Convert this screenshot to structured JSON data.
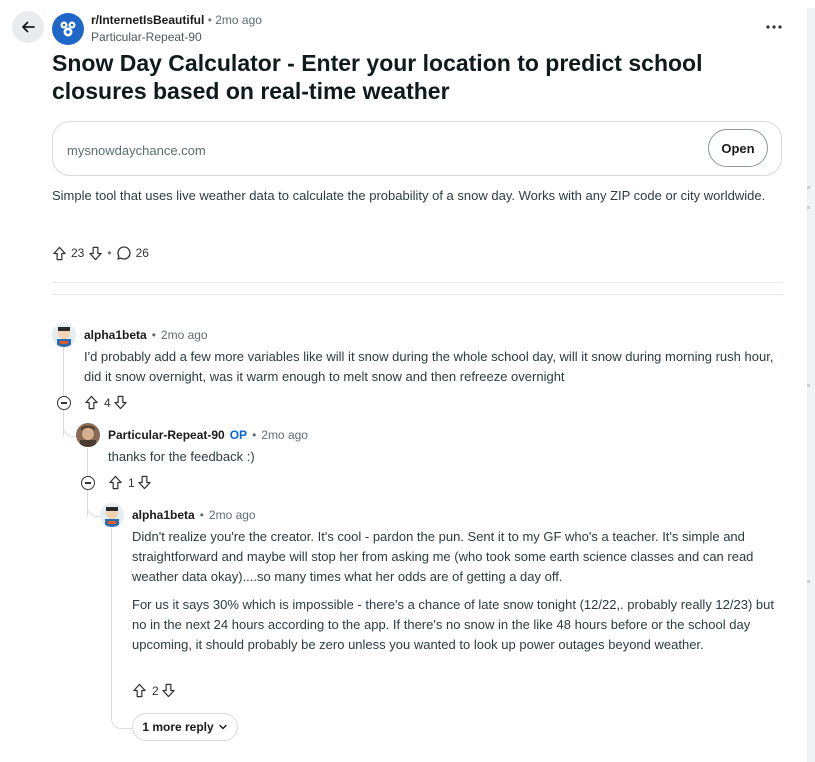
{
  "post": {
    "subreddit": "r/InternetIsBeautiful",
    "time": "2mo ago",
    "author": "Particular-Repeat-90",
    "title": "Snow Day Calculator - Enter your location to predict school closures based on real-time weather",
    "link_url": "mysnowdaychance.com",
    "open_label": "Open",
    "body": "Simple tool that uses live weather data to calculate the probability of a snow day. Works with any ZIP code or city worldwide.",
    "score": "23",
    "comment_count": "26"
  },
  "comments": [
    {
      "author": "alpha1beta",
      "time": "2mo ago",
      "text": "I'd probably add a few more variables like will it snow during the whole school day, will it snow during morning rush hour, did it snow overnight, was it warm enough to melt snow and then refreeze overnight",
      "score": "4"
    },
    {
      "author": "Particular-Repeat-90",
      "op_label": "OP",
      "time": "2mo ago",
      "text": "thanks for the feedback :)",
      "score": "1"
    },
    {
      "author": "alpha1beta",
      "time": "2mo ago",
      "text_p1": "Didn't realize you're the creator. It's cool - pardon the pun. Sent it to my GF who's a teacher. It's simple and straightforward and maybe will stop her from asking me (who took some earth science classes and can read weather data okay)....so many times what her odds are of getting a day off.",
      "text_p2": "For us it says 30% which is impossible - there's a chance of late snow tonight (12/22,. probably really 12/23) but no in the next 24 hours according to the app. If there's no snow in the like 48 hours before or the school day upcoming, it should probably be zero unless you wanted to look up power outages beyond weather.",
      "score": "2"
    }
  ],
  "more_replies_label": "1 more reply",
  "separator_dot": "•",
  "colors": {
    "op_blue": "#0a66d8",
    "subreddit_icon_bg": "#1f66c9"
  },
  "icons": [
    "back-arrow-icon",
    "subreddit-icon",
    "more-options-icon",
    "upvote-icon",
    "downvote-icon",
    "comment-icon",
    "collapse-icon",
    "chevron-down-icon"
  ]
}
